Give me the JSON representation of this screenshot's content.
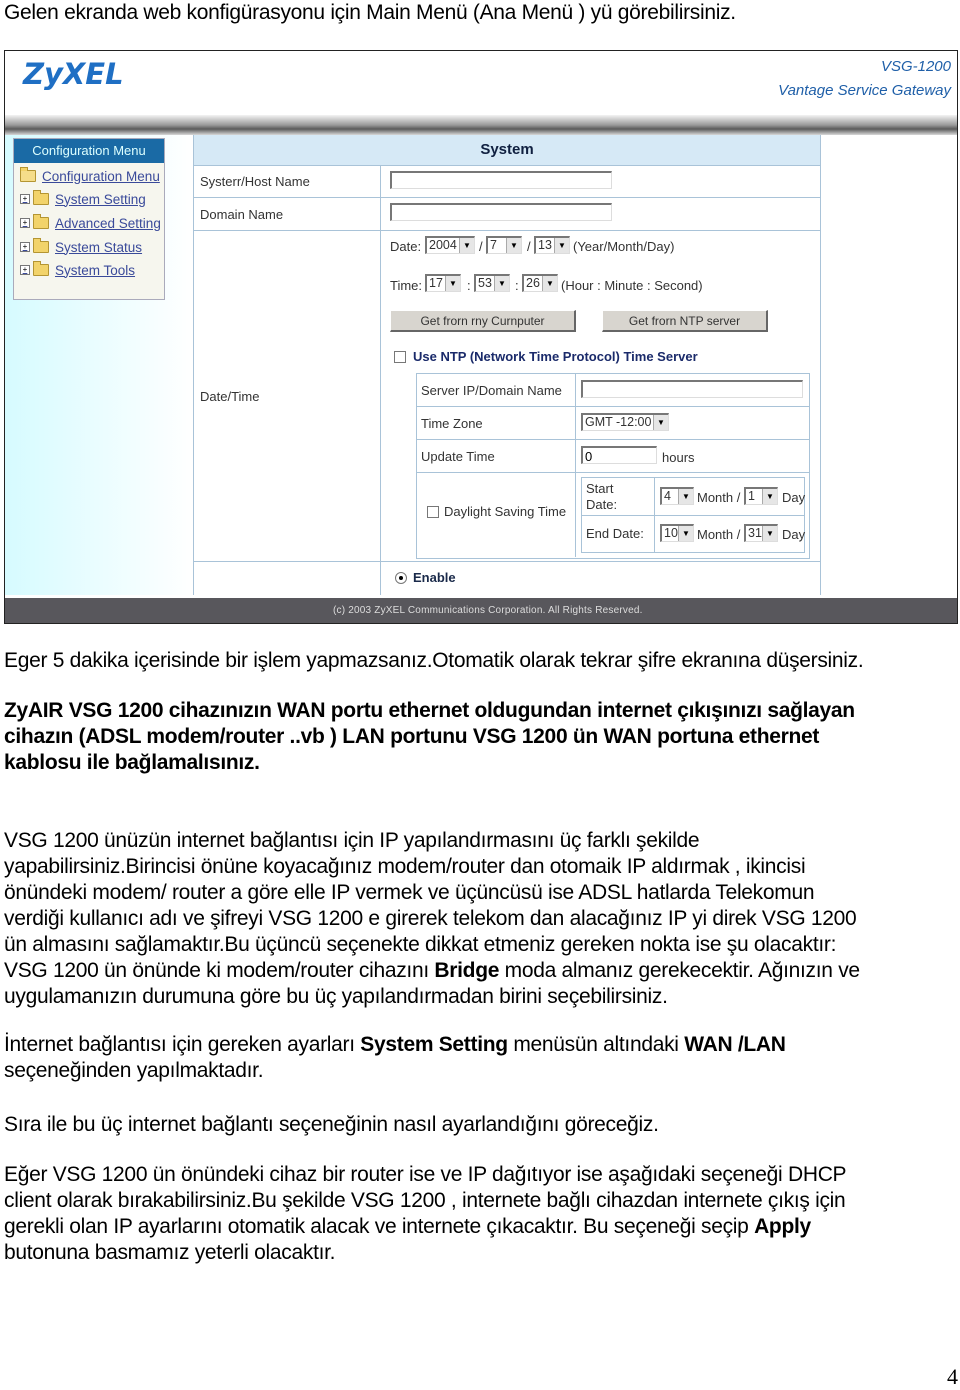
{
  "intro_text": "Gelen ekranda web konfigürasyonu için Main Menü (Ana Menü ) yü görebilirsiniz.",
  "screenshot": {
    "logo": "ZyXEL",
    "model_line1": "VSG-1200",
    "model_line2": "Vantage Service Gateway",
    "menu": {
      "header": "Configuration Menu",
      "root": "Configuration Menu",
      "items": [
        {
          "label": "System Setting",
          "icon": "folder-icon"
        },
        {
          "label": "Advanced Setting",
          "icon": "folder-icon"
        },
        {
          "label": "System Status",
          "icon": "folder-icon"
        },
        {
          "label": "System Tools",
          "icon": "folder-icon"
        }
      ]
    },
    "system": {
      "title": "System",
      "host_label": "Systerr/Host Name",
      "host_value": "",
      "domain_label": "Domain Name",
      "domain_value": "",
      "datetime_label": "Date/Time",
      "date_label": "Date:",
      "year": "2004",
      "month": "7",
      "day": "13",
      "date_sep": "/",
      "date_hint": "(Year/Month/Day)",
      "time_label": "Time:",
      "hour": "17",
      "minute": "53",
      "second": "26",
      "time_sep": ":",
      "time_hint": "(Hour : Minute : Second)",
      "btn_computer": "Get frorn rny Curnputer",
      "btn_ntp": "Get frorn NTP server",
      "ntp_checkbox_label": "Use NTP (Network Time Protocol) Time Server",
      "ntp": {
        "server_label": "Server IP/Domain Name",
        "server_value": "",
        "tz_label": "Time Zone",
        "tz_value": "GMT -12:00",
        "update_label": "Update Time",
        "update_value": "0",
        "update_unit": "hours",
        "dst_label": "Daylight Saving Time",
        "start_label": "Start Date:",
        "start_month": "4",
        "start_day": "1",
        "end_label": "End Date:",
        "end_month": "10",
        "end_day": "31",
        "month_word": "Month /",
        "day_word": "Day"
      },
      "enable_label": "Enable"
    },
    "footer": "(c) 2003 ZyXEL Communications Corporation. All Rights Reserved."
  },
  "paragraphs": {
    "p1": "Eger 5 dakika içerisinde bir işlem yapmazsanız.Otomatik olarak tekrar şifre ekranına düşersiniz.",
    "p2_l1": "ZyAIR VSG 1200 cihazınızın WAN portu ethernet oldugundan internet çıkışınızı sağlayan",
    "p2_l2": "cihazın (ADSL modem/router ..vb ) LAN portunu VSG 1200 ün WAN portuna ethernet",
    "p2_l3": "kablosu ile bağlamalısınız.",
    "p3_l1": "VSG 1200 ünüzün internet bağlantısı için IP yapılandırmasını üç farklı şekilde",
    "p3_l2": "yapabilirsiniz.Birincisi önüne koyacağınız modem/router dan otomaik IP aldırmak , ikincisi",
    "p3_l3": "önündeki modem/ router a göre elle IP vermek ve üçüncüsü ise ADSL hatlarda Telekomun",
    "p3_l4": "verdiği  kullanıcı adı ve şifreyi VSG 1200 e girerek telekom dan alacağınız IP yi direk VSG 1200",
    "p3_l5": "ün almasını sağlamaktır.Bu üçüncü seçenekte dikkat etmeniz gereken nokta ise şu olacaktır:",
    "p3_l6a": "VSG 1200 ün önünde ki modem/router cihazını ",
    "p3_l6b": "Bridge",
    "p3_l6c": " moda almanız gerekecektir. Ağınızın ve",
    "p3_l7": "uygulamanızın durumuna göre bu üç yapılandırmadan birini seçebilirsiniz.",
    "p4_l1a": "İnternet bağlantısı için gereken ayarları ",
    "p4_l1b": "System Setting",
    "p4_l1c": " menüsün altındaki ",
    "p4_l1d": "WAN /LAN",
    "p4_l2": "seçeneğinden yapılmaktadır.",
    "p5": "Sıra ile bu üç internet bağlantı seçeneğinin nasıl ayarlandığını göreceğiz.",
    "p6_l1": "Eğer VSG 1200 ün önündeki cihaz bir router ise ve IP dağıtıyor ise aşağıdaki seçeneği DHCP",
    "p6_l2": "client olarak bırakabilirsiniz.Bu şekilde  VSG 1200 , internete bağlı cihazdan internete çıkış için",
    "p6_l3a": "gerekli olan IP ayarlarını otomatik alacak  ve internete çıkacaktır. Bu seçeneği seçip  ",
    "p6_l3b": "Apply",
    "p6_l4": "butonuna basmamız yeterli olacaktır."
  },
  "page_number": "4"
}
